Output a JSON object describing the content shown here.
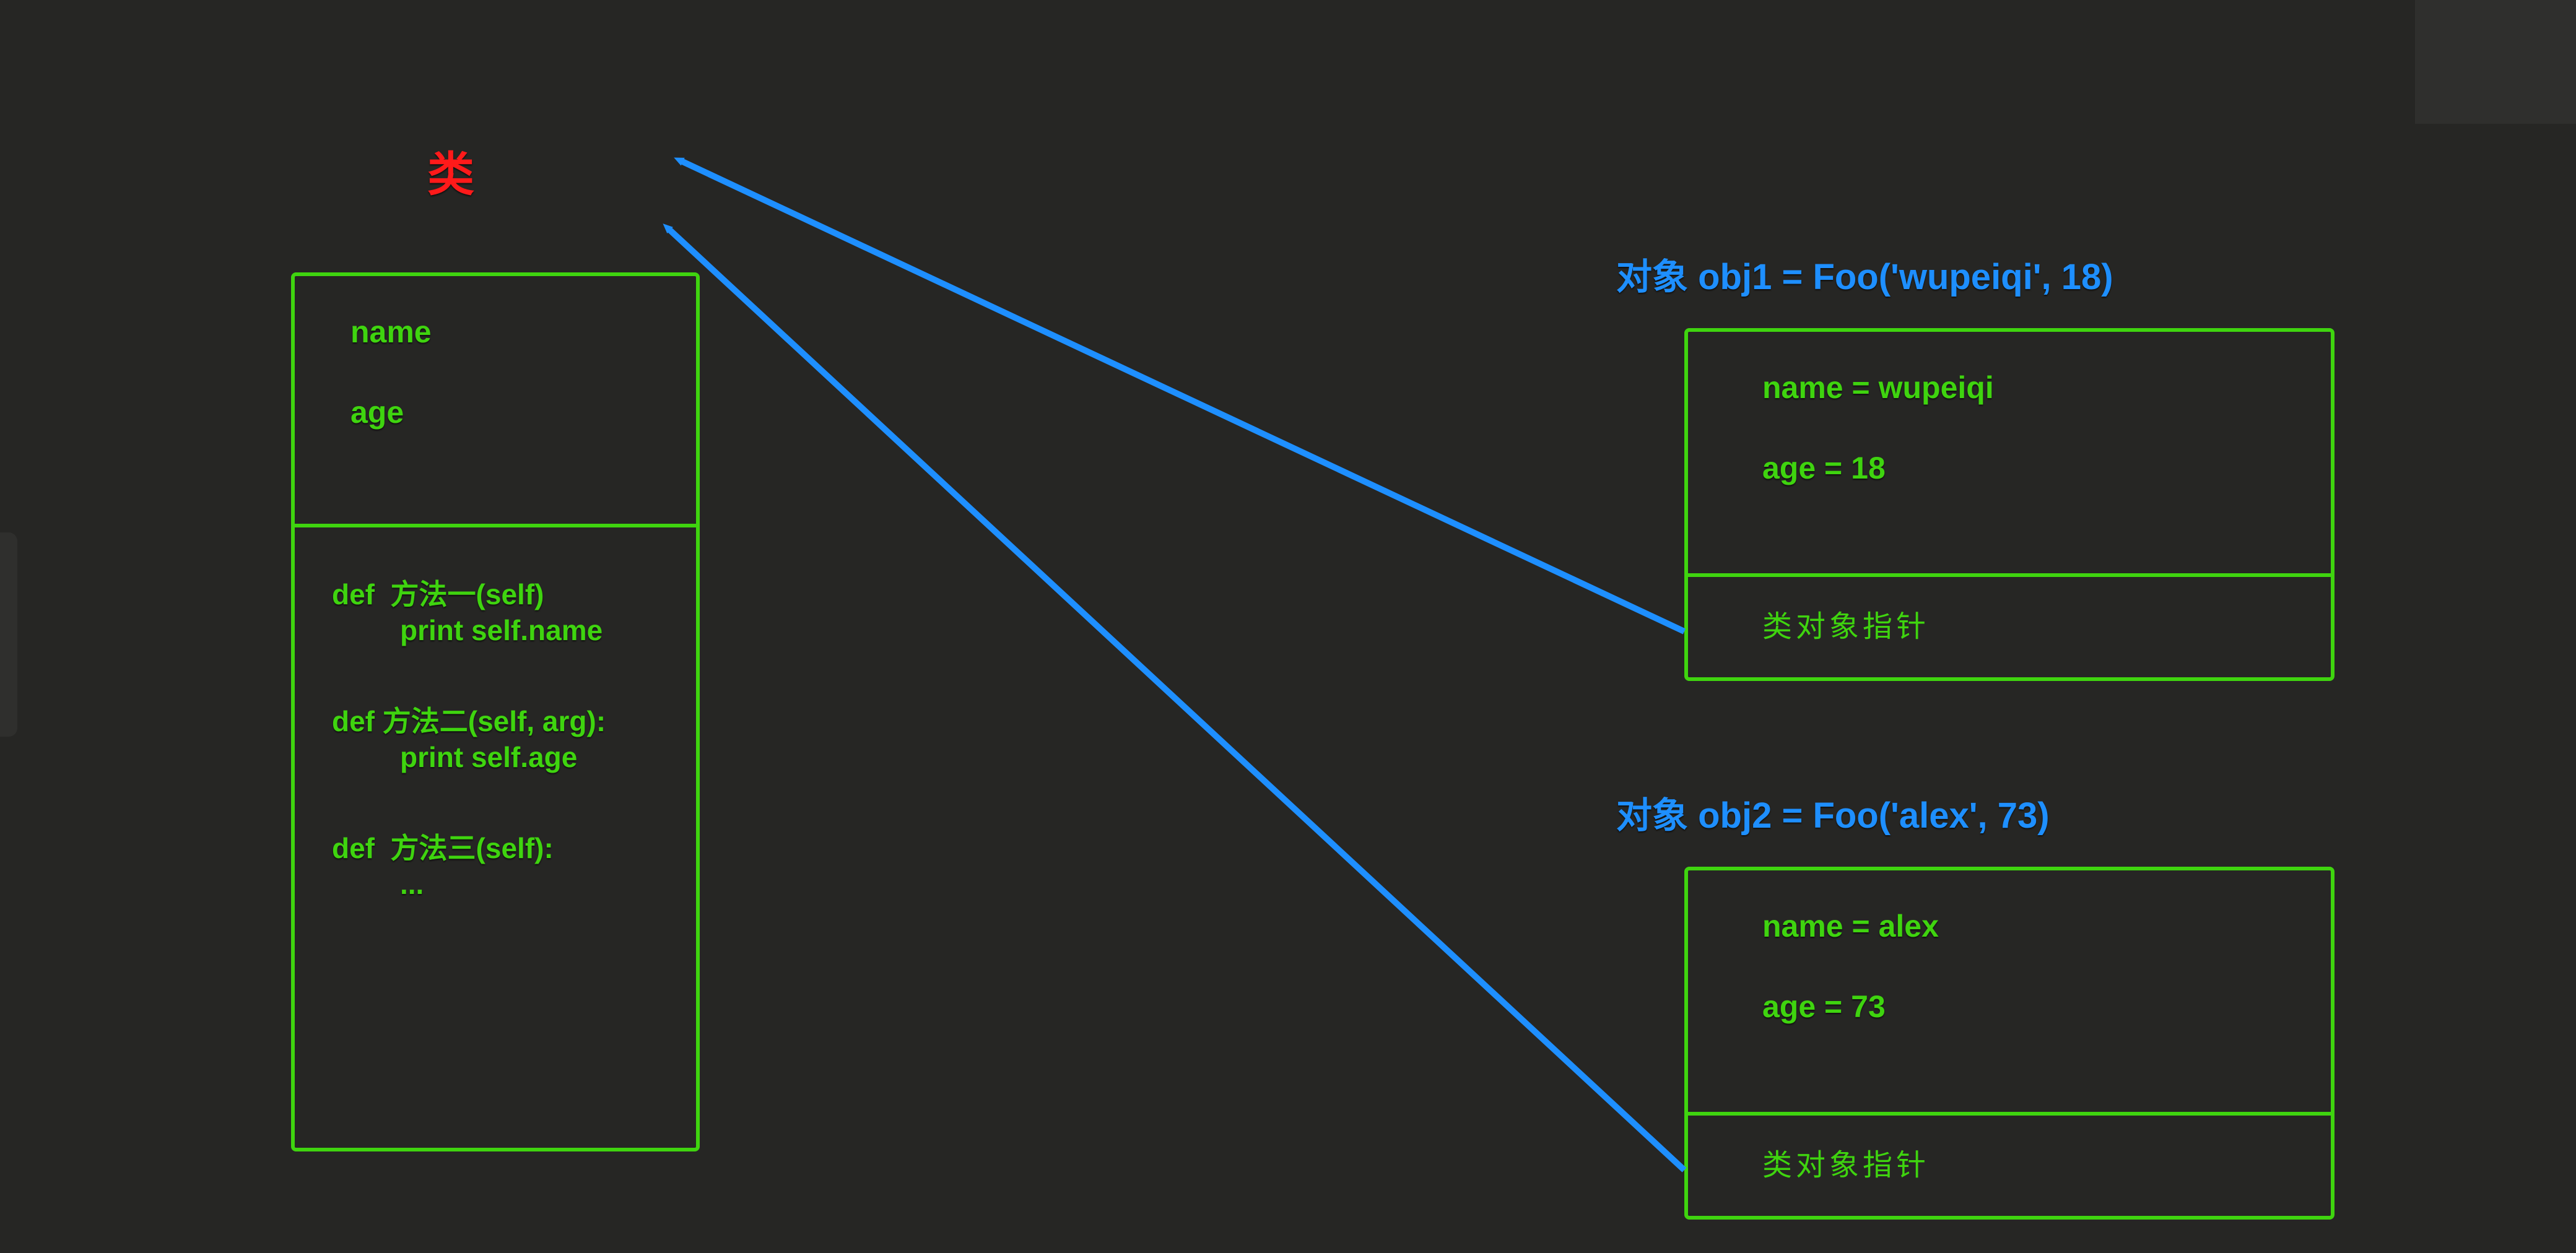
{
  "class": {
    "title": "类",
    "attributes": [
      "name",
      "age"
    ],
    "methods": [
      {
        "sig": "def  方法一(self)",
        "body": "print self.name"
      },
      {
        "sig": "def 方法二(self, arg):",
        "body": "print self.age"
      },
      {
        "sig": "def  方法三(self):",
        "body": "..."
      }
    ]
  },
  "obj1": {
    "title": "对象 obj1 = Foo('wupeiqi', 18)",
    "attrs": [
      "name = wupeiqi",
      "age = 18"
    ],
    "pointer": "类对象指针"
  },
  "obj2": {
    "title": "对象 obj2 = Foo('alex', 73)",
    "attrs": [
      "name = alex",
      "age = 73"
    ],
    "pointer": "类对象指针"
  },
  "colors": {
    "bg": "#262624",
    "border": "#3fd40f",
    "title": "#ff1a1a",
    "objtitle": "#1e8fff",
    "arrow": "#1e8fff"
  }
}
